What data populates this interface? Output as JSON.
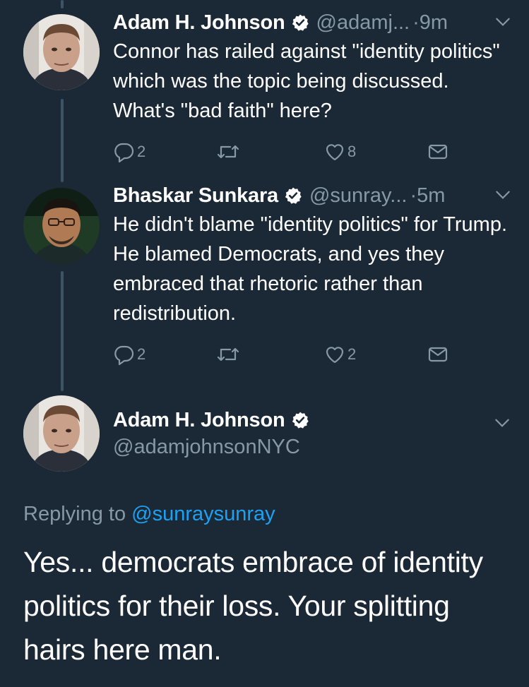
{
  "tweets": [
    {
      "name": "Adam H. Johnson",
      "handle": "@adamj...",
      "time": "·9m",
      "text": "Connor has railed against \"identity politics\" which was the topic being discussed. What's \"bad faith\" here?",
      "replies": "2",
      "likes": "8"
    },
    {
      "name": "Bhaskar Sunkara",
      "handle": "@sunray...",
      "time": "·5m",
      "text": "He didn't blame \"identity politics\" for Trump. He blamed Democrats, and yes they embraced that rhetoric rather than redistribution.",
      "replies": "2",
      "likes": "2"
    }
  ],
  "main": {
    "name": "Adam H. Johnson",
    "handle": "@adamjohnsonNYC",
    "replying_prefix": "Replying to",
    "replying_to": "@sunraysunray",
    "text": "Yes... democrats embrace of identity politics for their loss. Your splitting hairs here man."
  },
  "colors": {
    "background": "#1b2836",
    "secondary_text": "#8899a6",
    "link": "#1da1f2"
  },
  "icons": [
    "verified-icon",
    "chevron-down-icon",
    "reply-icon",
    "retweet-icon",
    "like-icon",
    "message-icon"
  ]
}
